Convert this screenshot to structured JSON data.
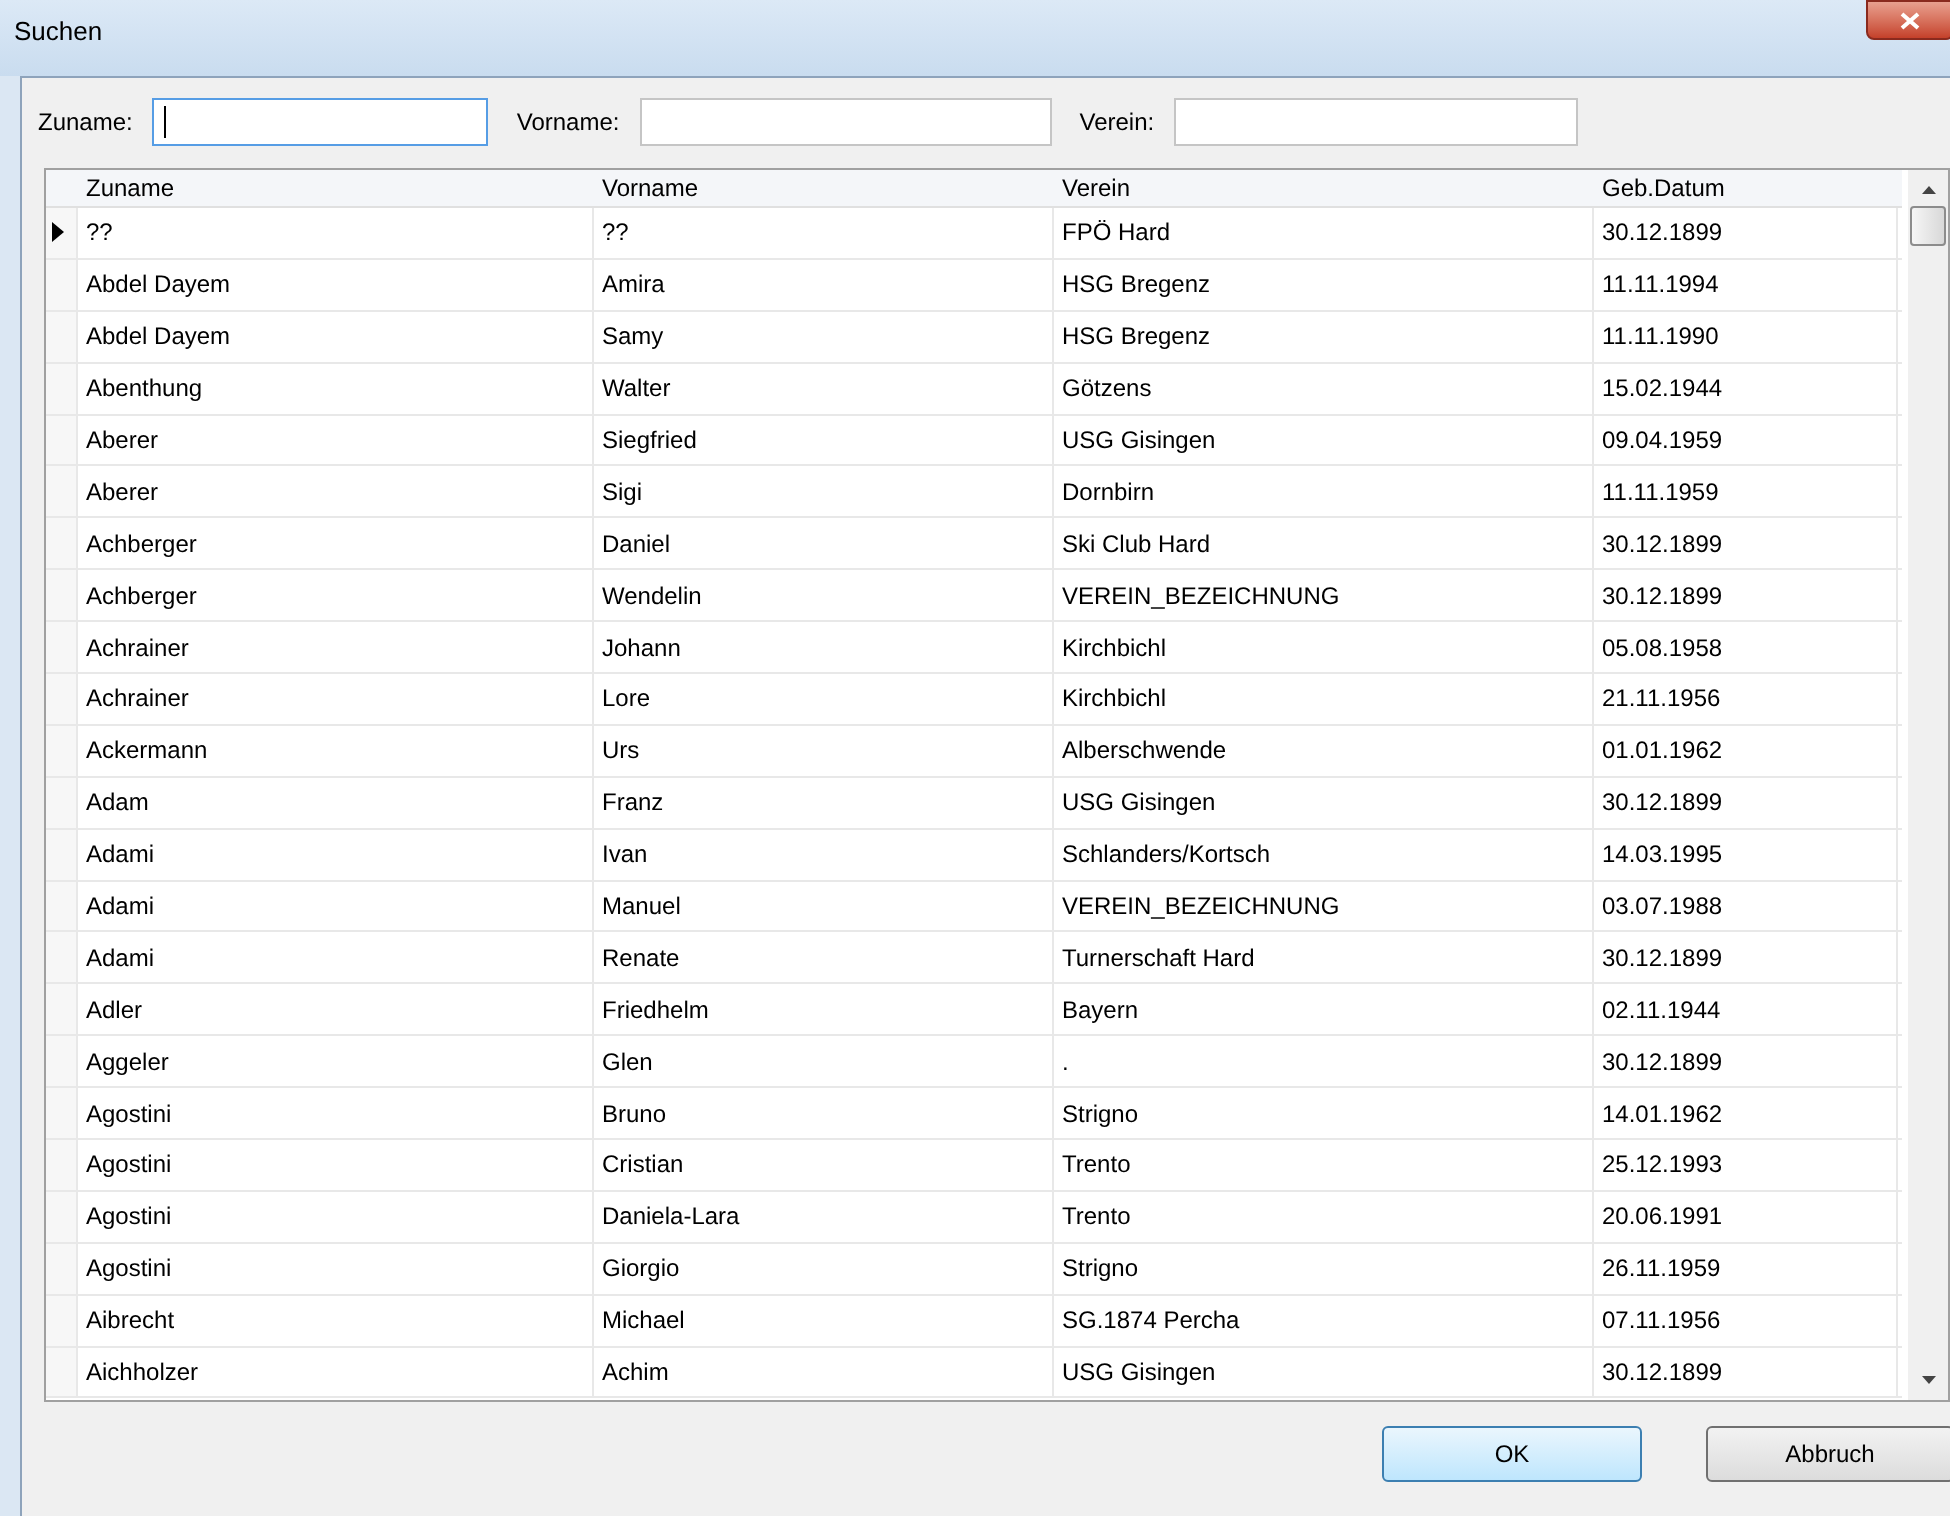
{
  "window": {
    "title": "Suchen"
  },
  "filters": [
    {
      "label": "Zuname:",
      "focused": true
    },
    {
      "label": "Vorname:",
      "focused": false
    },
    {
      "label": "Verein:",
      "focused": false
    }
  ],
  "table": {
    "columns": [
      "Zuname",
      "Vorname",
      "Verein",
      "Geb.Datum"
    ],
    "rows": [
      {
        "current": true,
        "cells": [
          "??",
          "??",
          "FPÖ Hard",
          "30.12.1899"
        ]
      },
      {
        "current": false,
        "cells": [
          "Abdel Dayem",
          "Amira",
          "HSG Bregenz",
          "11.11.1994"
        ]
      },
      {
        "current": false,
        "cells": [
          "Abdel Dayem",
          "Samy",
          "HSG Bregenz",
          "11.11.1990"
        ]
      },
      {
        "current": false,
        "cells": [
          "Abenthung",
          "Walter",
          "Götzens",
          "15.02.1944"
        ]
      },
      {
        "current": false,
        "cells": [
          "Aberer",
          "Siegfried",
          "USG Gisingen",
          "09.04.1959"
        ]
      },
      {
        "current": false,
        "cells": [
          "Aberer",
          "Sigi",
          "Dornbirn",
          "11.11.1959"
        ]
      },
      {
        "current": false,
        "cells": [
          "Achberger",
          "Daniel",
          "Ski Club Hard",
          "30.12.1899"
        ]
      },
      {
        "current": false,
        "cells": [
          "Achberger",
          "Wendelin",
          "VEREIN_BEZEICHNUNG",
          "30.12.1899"
        ]
      },
      {
        "current": false,
        "cells": [
          "Achrainer",
          "Johann",
          "Kirchbichl",
          "05.08.1958"
        ]
      },
      {
        "current": false,
        "cells": [
          "Achrainer",
          "Lore",
          "Kirchbichl",
          "21.11.1956"
        ]
      },
      {
        "current": false,
        "cells": [
          "Ackermann",
          "Urs",
          "Alberschwende",
          "01.01.1962"
        ]
      },
      {
        "current": false,
        "cells": [
          "Adam",
          "Franz",
          "USG Gisingen",
          "30.12.1899"
        ]
      },
      {
        "current": false,
        "cells": [
          "Adami",
          "Ivan",
          "Schlanders/Kortsch",
          "14.03.1995"
        ]
      },
      {
        "current": false,
        "cells": [
          "Adami",
          "Manuel",
          "VEREIN_BEZEICHNUNG",
          "03.07.1988"
        ]
      },
      {
        "current": false,
        "cells": [
          "Adami",
          "Renate",
          "Turnerschaft Hard",
          "30.12.1899"
        ]
      },
      {
        "current": false,
        "cells": [
          "Adler",
          "Friedhelm",
          "Bayern",
          "02.11.1944"
        ]
      },
      {
        "current": false,
        "cells": [
          "Aggeler",
          "Glen",
          ".",
          "30.12.1899"
        ]
      },
      {
        "current": false,
        "cells": [
          "Agostini",
          "Bruno",
          "Strigno",
          "14.01.1962"
        ]
      },
      {
        "current": false,
        "cells": [
          "Agostini",
          "Cristian",
          "Trento",
          "25.12.1993"
        ]
      },
      {
        "current": false,
        "cells": [
          "Agostini",
          "Daniela-Lara",
          "Trento",
          "20.06.1991"
        ]
      },
      {
        "current": false,
        "cells": [
          "Agostini",
          "Giorgio",
          "Strigno",
          "26.11.1959"
        ]
      },
      {
        "current": false,
        "cells": [
          "Aibrecht",
          "Michael",
          "SG.1874 Percha",
          "07.11.1956"
        ]
      },
      {
        "current": false,
        "cells": [
          "Aichholzer",
          "Achim",
          "USG Gisingen",
          "30.12.1899"
        ]
      }
    ]
  },
  "buttons": [
    {
      "label": "OK",
      "default": true
    },
    {
      "label": "Abbruch",
      "default": false
    }
  ]
}
